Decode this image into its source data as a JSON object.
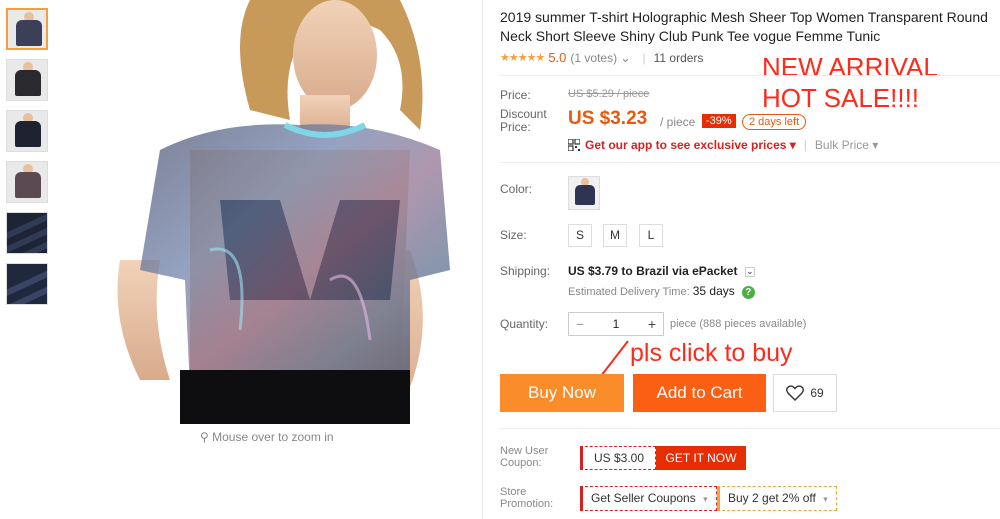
{
  "thumbnails": [
    {
      "name": "thumb-1",
      "active": true
    },
    {
      "name": "thumb-2",
      "active": false
    },
    {
      "name": "thumb-3",
      "active": false
    },
    {
      "name": "thumb-4",
      "active": false
    },
    {
      "name": "thumb-5",
      "active": false
    },
    {
      "name": "thumb-6",
      "active": false
    }
  ],
  "gallery": {
    "zoom_hint": "Mouse over to zoom in",
    "zoom_icon": "magnifier-icon"
  },
  "product": {
    "title": "2019 summer T-shirt Holographic Mesh Sheer Top Women Transparent Round Neck Short Sleeve Shiny Club Punk Tee vogue Femme Tunic",
    "stars": "★★★★★",
    "rating": "5.0",
    "votes": "(1 votes)",
    "votes_caret": "⌄",
    "separator": "|",
    "orders": "11 orders"
  },
  "promo_overlay": {
    "line1": "NEW ARRIVAL",
    "line2": "HOT SALE!!!!"
  },
  "price": {
    "price_label": "Price:",
    "original": "US $5.29 / piece",
    "discount_label_1": "Discount",
    "discount_label_2": "Price:",
    "discount": "US $3.23",
    "per_piece": "/ piece",
    "discount_pct": "-39%",
    "days_left": "2 days left",
    "app_prices": "Get our app to see exclusive prices",
    "app_caret": "▾",
    "bulk_price": "Bulk Price",
    "bulk_caret": "▾"
  },
  "options": {
    "color_label": "Color:",
    "size_label": "Size:",
    "sizes": [
      "S",
      "M",
      "L"
    ]
  },
  "shipping": {
    "label": "Shipping:",
    "cost": "US $3.79",
    "to": "to",
    "destination": "Brazil via ePacket",
    "chevron": "⌄",
    "estimated_label": "Estimated Delivery Time:",
    "estimated_days": "35 days",
    "help": "?"
  },
  "quantity": {
    "label": "Quantity:",
    "minus": "−",
    "value": "1",
    "plus": "+",
    "available": "piece (888 pieces available)"
  },
  "annotation": {
    "click_note": "pls click to buy"
  },
  "actions": {
    "buy_now": "Buy Now",
    "add_to_cart": "Add to Cart",
    "wishlist_count": "69"
  },
  "coupons": {
    "new_user_label_1": "New User",
    "new_user_label_2": "Coupon:",
    "coupon_amount": "US $3.00",
    "get_it_now": "GET IT NOW",
    "store_label_1": "Store",
    "store_label_2": "Promotion:",
    "seller_coupons": "Get Seller Coupons",
    "bundle_offer": "Buy 2 get 2% off",
    "caret": "▾"
  },
  "colors": {
    "accent_orange": "#fb8c2a",
    "cart_orange": "#fb5f14",
    "price_red": "#e8590c",
    "badge_red": "#e62e04",
    "annotation_red": "#ff2b1a"
  }
}
